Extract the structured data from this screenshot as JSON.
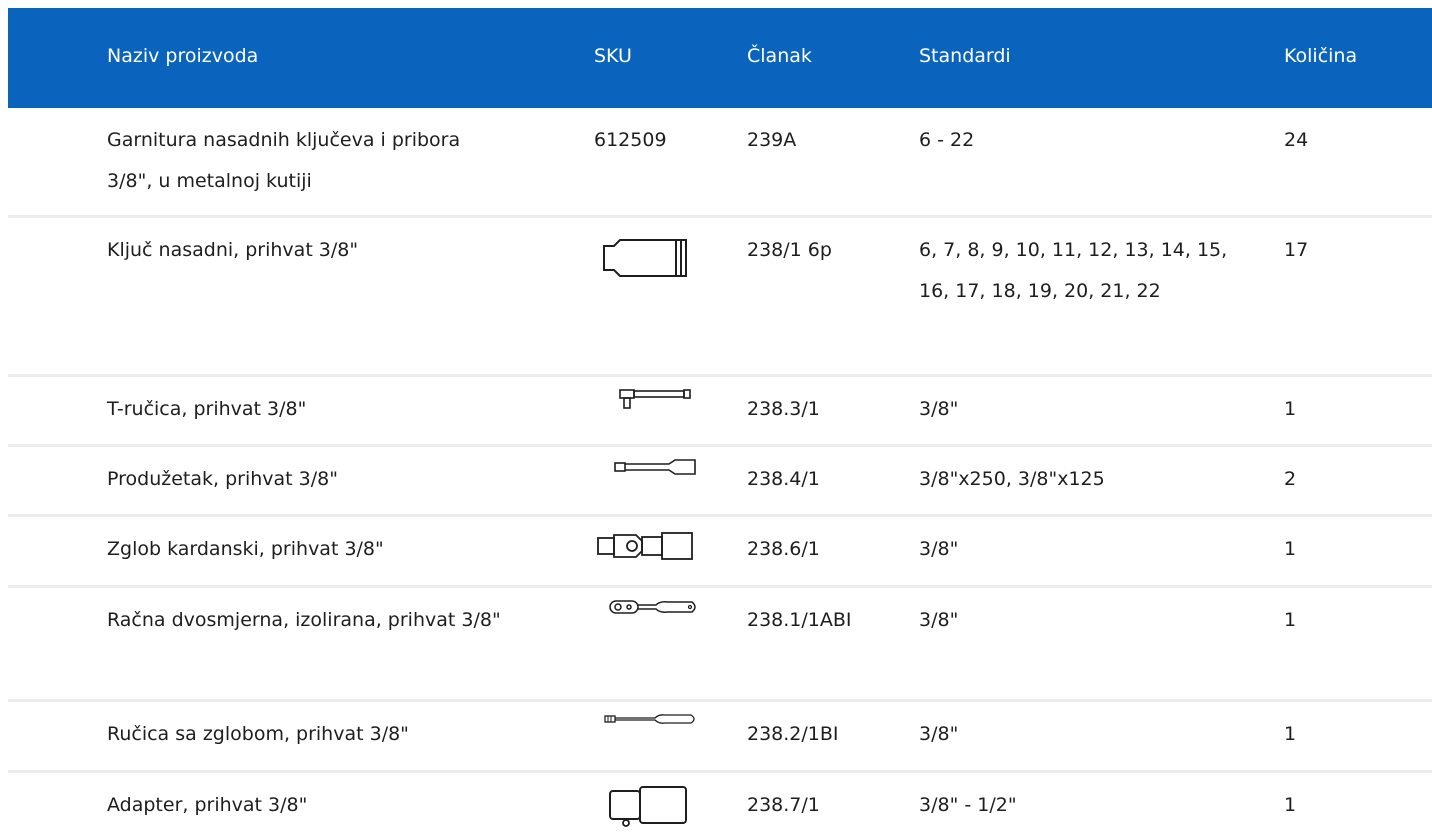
{
  "header": {
    "name": "Naziv proizvoda",
    "sku": "SKU",
    "article": "Članak",
    "standards": "Standardi",
    "quantity": "Količina"
  },
  "rows": [
    {
      "name": "Garnitura nasadnih ključeva i pribora 3/8\", u metalnoj kutiji",
      "sku": "612509",
      "article": "239A",
      "standards": "6 - 22",
      "quantity": "24"
    },
    {
      "name": "Ključ nasadni, prihvat 3/8\"",
      "icon": "socket-icon",
      "article": "238/1 6p",
      "standards": "6, 7, 8, 9, 10, 11, 12, 13, 14, 15, 16, 17, 18, 19, 20, 21, 22",
      "quantity": "17"
    },
    {
      "name": "T-ručica, prihvat 3/8\"",
      "icon": "t-handle-icon",
      "article": "238.3/1",
      "standards": "3/8\"",
      "quantity": "1"
    },
    {
      "name": "Produžetak, prihvat 3/8\"",
      "icon": "extension-bar-icon",
      "article": "238.4/1",
      "standards": "3/8\"x250, 3/8\"x125",
      "quantity": "2"
    },
    {
      "name": "Zglob kardanski, prihvat 3/8\"",
      "icon": "universal-joint-icon",
      "article": "238.6/1",
      "standards": "3/8\"",
      "quantity": "1"
    },
    {
      "name": "Račna dvosmjerna, izolirana, prihvat 3/8\"",
      "icon": "ratchet-icon",
      "article": "238.1/1ABI",
      "standards": "3/8\"",
      "quantity": "1"
    },
    {
      "name": "Ručica sa zglobom, prihvat 3/8\"",
      "icon": "hinged-handle-icon",
      "article": "238.2/1BI",
      "standards": "3/8\"",
      "quantity": "1"
    },
    {
      "name": "Adapter, prihvat 3/8\"",
      "icon": "adapter-icon",
      "article": "238.7/1",
      "standards": "3/8\" - 1/2\"",
      "quantity": "1"
    }
  ],
  "colors": {
    "header_bg": "#0a64be",
    "header_text": "#ffffff",
    "row_divider": "#ececec"
  }
}
